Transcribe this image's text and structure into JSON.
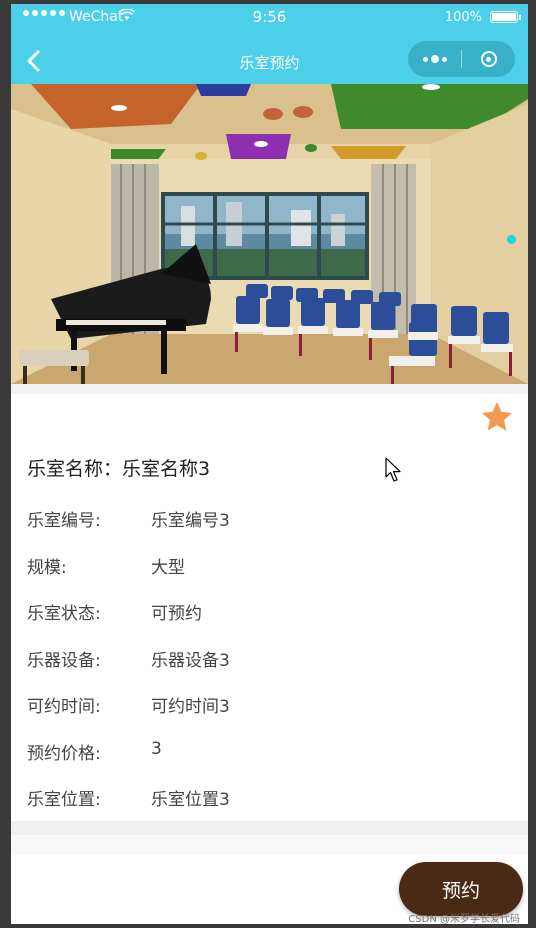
{
  "status_bar": {
    "carrier": "WeChat",
    "time": "9:56",
    "battery_text": "100%",
    "battery_level": 1.0
  },
  "nav": {
    "title": "乐室预约",
    "back_icon": "chevron-left-icon",
    "more_icon": "more-dots-icon",
    "close_icon": "target-circle-icon"
  },
  "banner": {
    "active_dot_color": "#22d3ee"
  },
  "favorite_icon": "star-icon",
  "room": {
    "name_label": "乐室名称：",
    "name_value": "乐室名称3"
  },
  "details": [
    {
      "label": "乐室编号:",
      "value": "乐室编号3"
    },
    {
      "label": "规模:",
      "value": "大型"
    },
    {
      "label": "乐室状态:",
      "value": "可预约"
    },
    {
      "label": "乐器设备:",
      "value": "乐器设备3"
    },
    {
      "label": "可约时间:",
      "value": "可约时间3"
    },
    {
      "label": "预约价格:",
      "value": "3"
    },
    {
      "label": "乐室位置:",
      "value": "乐室位置3"
    }
  ],
  "book_button": "预约",
  "watermark": "CSDN @米罗学长爱代码",
  "colors": {
    "nav_bg": "#4ccfe9",
    "star": "#ef9a4c",
    "button_bg": "#4a2a16"
  }
}
